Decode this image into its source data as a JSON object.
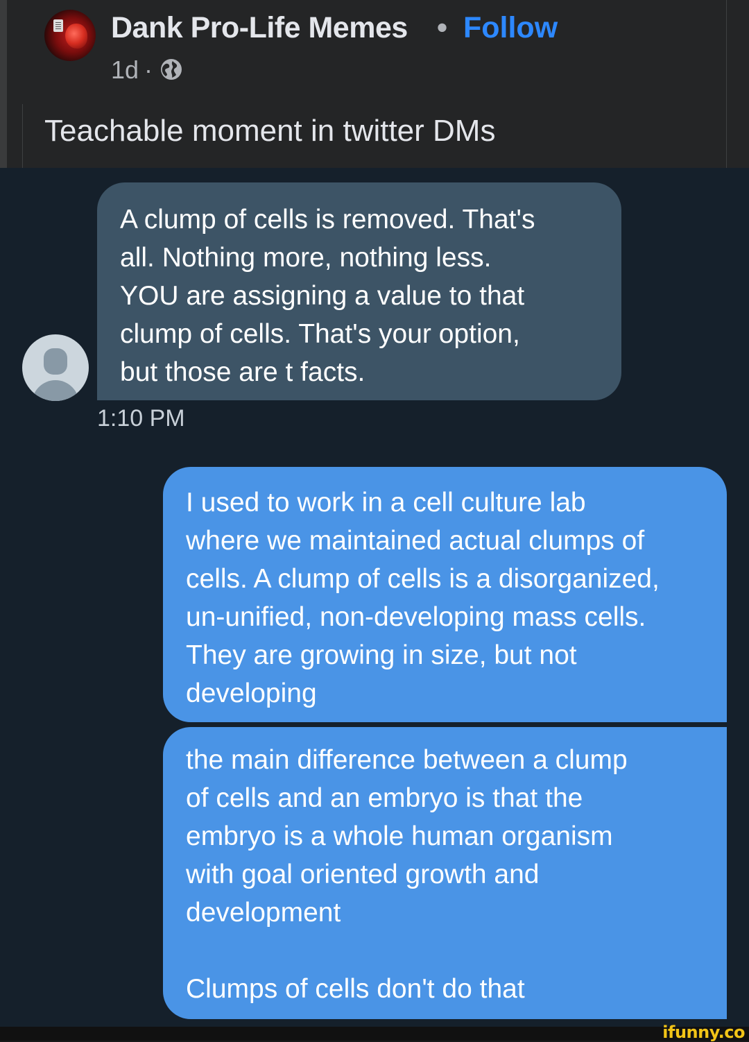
{
  "post": {
    "page_name": "Dank Pro-Life Memes",
    "separator": "•",
    "follow_label": "Follow",
    "time": "1d",
    "time_separator": "·",
    "audience_icon": "globe-icon",
    "caption": "Teachable moment in twitter DMs"
  },
  "dm": {
    "received": {
      "text": "A clump of cells is removed. That's\nall. Nothing more, nothing less.\nYOU are assigning a value to that\nclump of cells. That's your option,\nbut those are t facts.",
      "timestamp": "1:10 PM"
    },
    "sent": [
      {
        "text": "I used to work in a cell culture lab\nwhere we maintained actual clumps of\ncells. A clump of cells is a disorganized,\nun-unified, non-developing mass cells.\nThey are growing in size, but not\ndeveloping"
      },
      {
        "text": "the main difference between a clump\nof cells and an embryo is that the\nembryo is a whole human organism\nwith goal oriented growth and\ndevelopment\n\nClumps of cells don't do that"
      }
    ]
  },
  "watermark": "ifunny.co",
  "colors": {
    "fb_background": "#242526",
    "follow_blue": "#2d88ff",
    "dm_background": "#15202b",
    "received_bubble": "#3d5466",
    "sent_bubble": "#4a94e6",
    "watermark_yellow": "#f2c417"
  }
}
